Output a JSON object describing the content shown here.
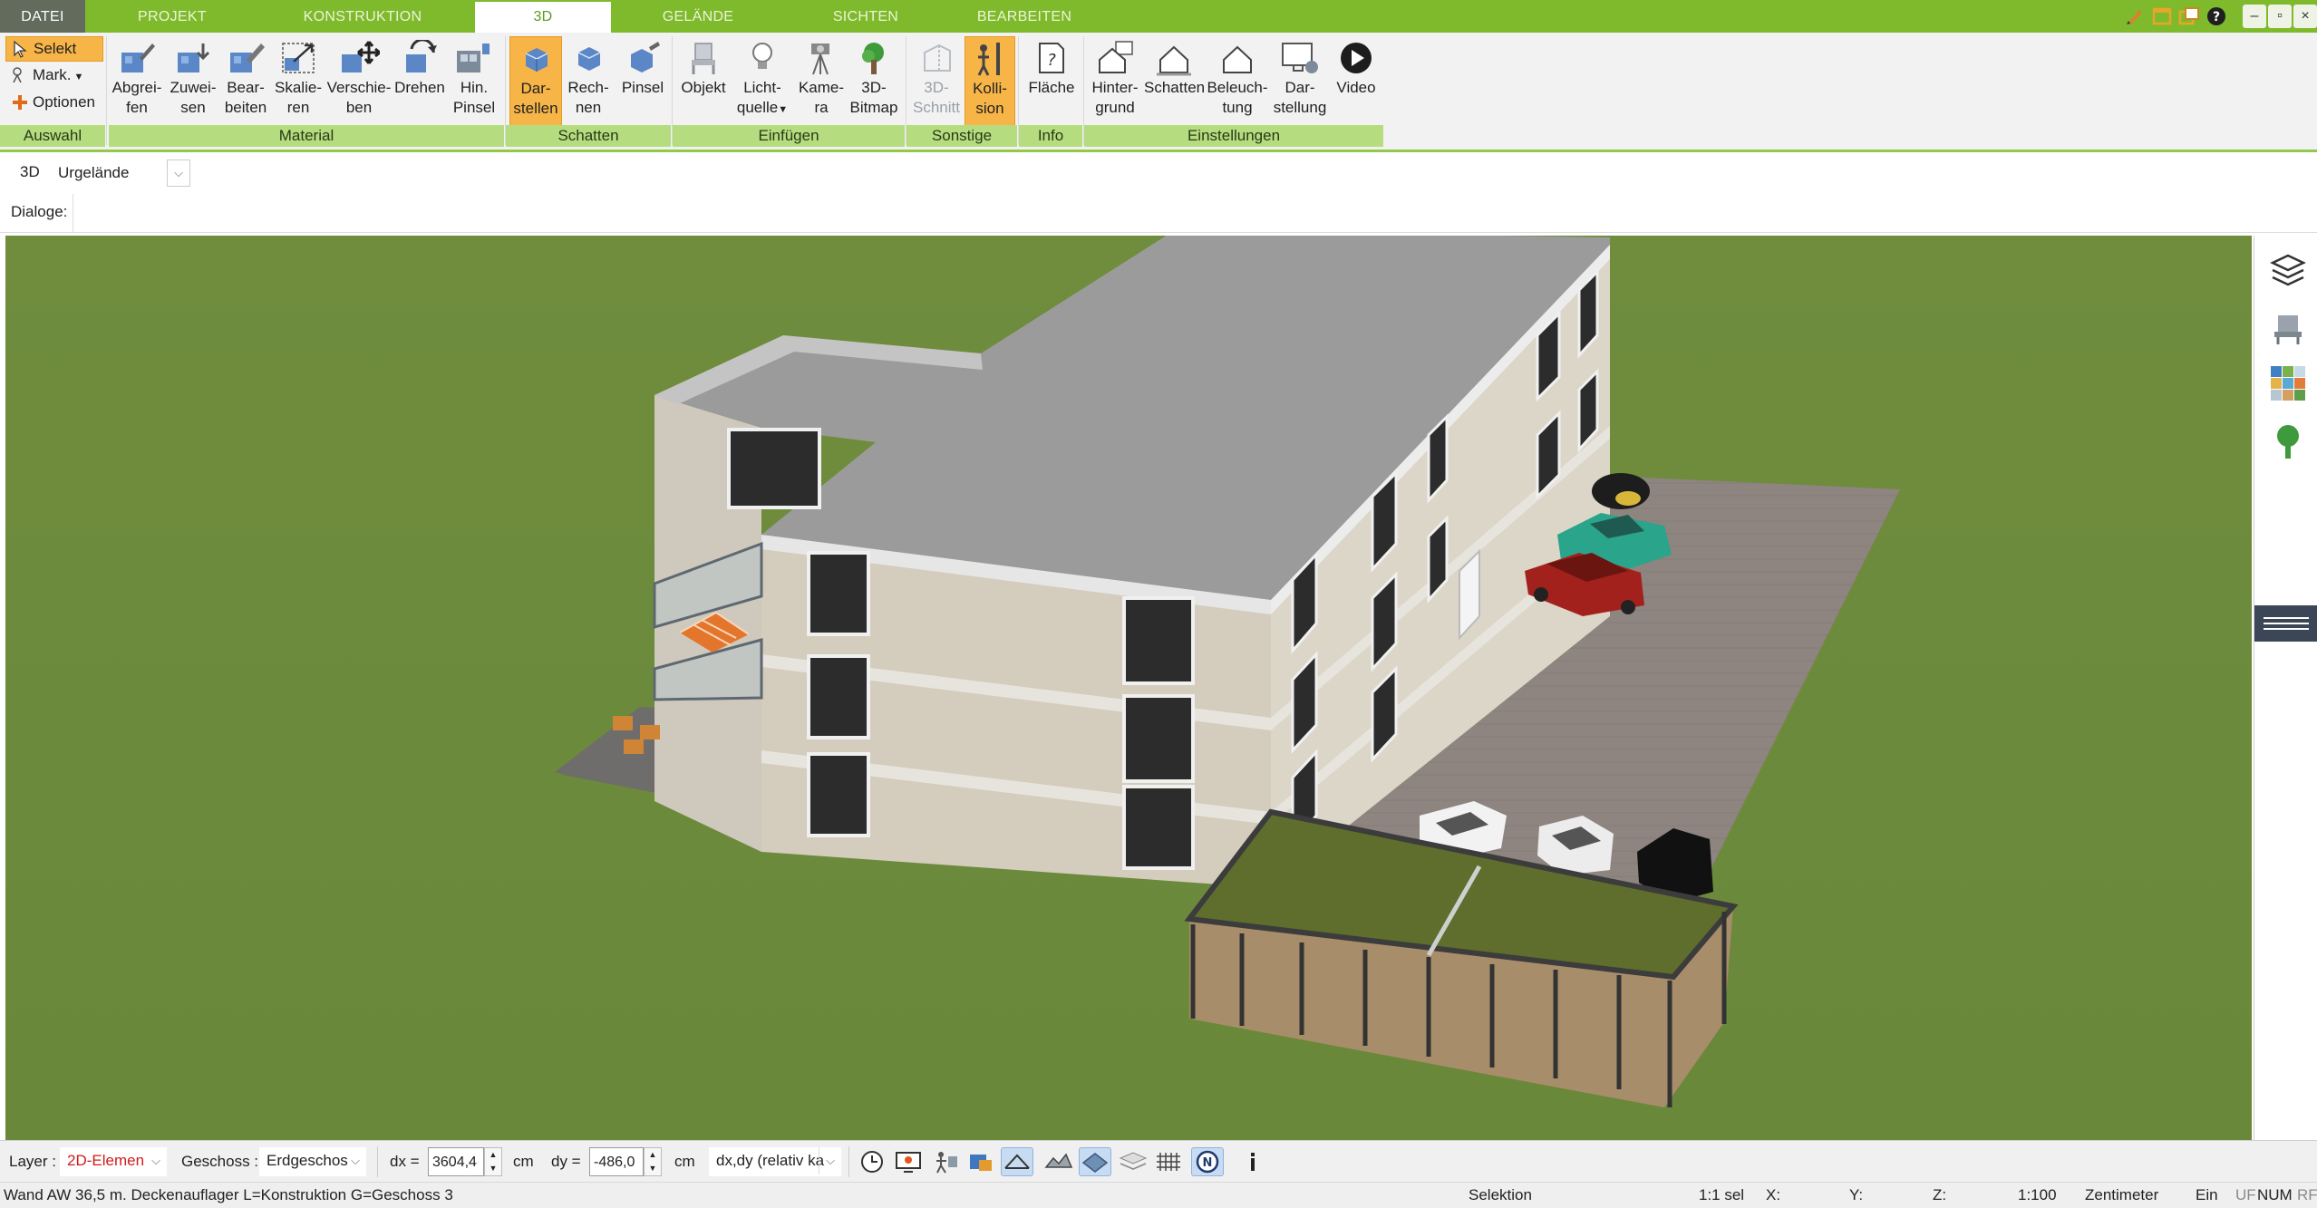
{
  "menu": {
    "tabs": [
      "DATEI",
      "PROJEKT",
      "KONSTRUKTION",
      "3D",
      "GELÄNDE",
      "SICHTEN",
      "BEARBEITEN"
    ],
    "active": "3D"
  },
  "ribbon": {
    "auswahl": {
      "selekt": "Selekt",
      "mark": "Mark.",
      "optionen": "Optionen",
      "group": "Auswahl"
    },
    "material": {
      "group": "Material",
      "buttons": [
        {
          "l1": "Abgrei-",
          "l2": "fen"
        },
        {
          "l1": "Zuwei-",
          "l2": "sen"
        },
        {
          "l1": "Bear-",
          "l2": "beiten"
        },
        {
          "l1": "Skalie-",
          "l2": "ren"
        },
        {
          "l1": "Verschie-",
          "l2": "ben"
        },
        {
          "l1": "Drehen",
          "l2": ""
        },
        {
          "l1": "Hin.",
          "l2": "Pinsel"
        }
      ]
    },
    "schatten": {
      "group": "Schatten",
      "buttons": [
        {
          "l1": "Dar-",
          "l2": "stellen"
        },
        {
          "l1": "Rech-",
          "l2": "nen"
        },
        {
          "l1": "Pinsel",
          "l2": ""
        }
      ]
    },
    "einfuegen": {
      "group": "Einfügen",
      "buttons": [
        {
          "l1": "Objekt",
          "l2": ""
        },
        {
          "l1": "Licht-",
          "l2": "quelle"
        },
        {
          "l1": "Kame-",
          "l2": "ra"
        },
        {
          "l1": "3D-",
          "l2": "Bitmap"
        }
      ]
    },
    "sonstige": {
      "group": "Sonstige",
      "buttons": [
        {
          "l1": "3D-",
          "l2": "Schnitt"
        },
        {
          "l1": "Kolli-",
          "l2": "sion"
        }
      ]
    },
    "info": {
      "group": "Info",
      "buttons": [
        {
          "l1": "Fläche",
          "l2": ""
        }
      ]
    },
    "einstellungen": {
      "group": "Einstellungen",
      "buttons": [
        {
          "l1": "Hinter-",
          "l2": "grund"
        },
        {
          "l1": "Schatten",
          "l2": ""
        },
        {
          "l1": "Beleuch-",
          "l2": "tung"
        },
        {
          "l1": "Dar-",
          "l2": "stellung"
        },
        {
          "l1": "Video",
          "l2": ""
        }
      ]
    }
  },
  "toolbar": {
    "mode": "3D",
    "terrain": "Urgelände",
    "dialoge": "Dialoge:"
  },
  "bottom": {
    "layer_label": "Layer :",
    "layer_value": "2D-Elemen",
    "geschoss_label": "Geschoss :",
    "geschoss_value": "Erdgeschos",
    "dx_label": "dx =",
    "dx_value": "3604,4",
    "dy_label": "dy =",
    "dy_value": "-486,0",
    "unit": "cm",
    "mode_value": "dx,dy (relativ ka"
  },
  "status": {
    "left": "Wand AW 36,5 m. Deckenauflager L=Konstruktion G=Geschoss 3",
    "selection": "Selektion",
    "sel": "1:1 sel",
    "x": "X:",
    "y": "Y:",
    "z": "Z:",
    "scale": "1:100",
    "unit": "Zentimeter",
    "ein": "Ein",
    "uf": "UF",
    "num": "NUM",
    "rf": "RF"
  },
  "colors": {
    "accent_green": "#7fba2c",
    "ribbon_group": "#b6dc80",
    "active_button": "#f7b548",
    "lawn": "#6c8a3c"
  }
}
